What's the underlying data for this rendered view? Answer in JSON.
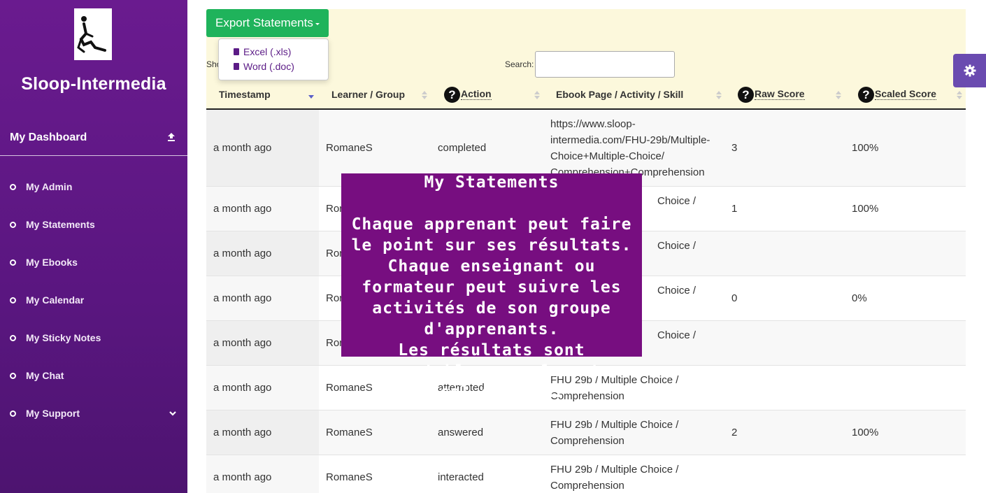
{
  "sidebar": {
    "brand": "Sloop-Intermedia",
    "dashboard_label": "My Dashboard",
    "items": [
      {
        "label": "My Admin"
      },
      {
        "label": "My Statements"
      },
      {
        "label": "My Ebooks"
      },
      {
        "label": "My Calendar"
      },
      {
        "label": "My Sticky Notes"
      },
      {
        "label": "My Chat"
      },
      {
        "label": "My Support"
      }
    ]
  },
  "toolbar": {
    "export_label": "Export Statements",
    "export_options": [
      "Excel (.xls)",
      "Word (.doc)"
    ],
    "show_label": "Sho",
    "search_label": "Search:",
    "search_value": ""
  },
  "table": {
    "headers": [
      "Timestamp",
      "Learner / Group",
      "Action",
      "Ebook Page / Activity / Skill",
      "Raw Score",
      "Scaled Score"
    ],
    "rows": [
      {
        "ts": "a month ago",
        "learner": "RomaneS",
        "action": "completed",
        "ebook": [
          "https://www.sloop-",
          "intermedia.com/FHU-29b/Multiple-",
          "Choice+Multiple-Choice/",
          "Comprehension+Comprehension"
        ],
        "raw": "3",
        "scaled": "100%"
      },
      {
        "ts": "a month ago",
        "learner": "Ror",
        "action": "",
        "ebook": [
          "Choice /"
        ],
        "raw": "1",
        "scaled": "100%"
      },
      {
        "ts": "a month ago",
        "learner": "Ror",
        "action": "",
        "ebook": [
          "Choice /"
        ],
        "raw": "",
        "scaled": ""
      },
      {
        "ts": "a month ago",
        "learner": "Ror",
        "action": "",
        "ebook": [
          "Choice /"
        ],
        "raw": "0",
        "scaled": "0%"
      },
      {
        "ts": "a month ago",
        "learner": "Ror",
        "action": "",
        "ebook": [
          "Choice /"
        ],
        "raw": "",
        "scaled": ""
      },
      {
        "ts": "a month ago",
        "learner": "RomaneS",
        "action": "attempted",
        "ebook": [
          "FHU 29b / Multiple Choice /",
          "Comprehension"
        ],
        "raw": "",
        "scaled": ""
      },
      {
        "ts": "a month ago",
        "learner": "RomaneS",
        "action": "answered",
        "ebook": [
          "FHU 29b / Multiple Choice /",
          "Comprehension"
        ],
        "raw": "2",
        "scaled": "100%"
      },
      {
        "ts": "a month ago",
        "learner": "RomaneS",
        "action": "interacted",
        "ebook": [
          "FHU 29b / Multiple Choice /",
          "Comprehension"
        ],
        "raw": "",
        "scaled": ""
      }
    ]
  },
  "overlay": {
    "title": "My Statements",
    "body": "Chaque apprenant peut faire le point sur ses résultats.\nChaque enseignant ou formateur peut suivre les activités de son groupe d'apprenants.\nLes résultats sont exportables aux formats Excel ou Word."
  },
  "colors": {
    "sidebar": "#6a1b8f",
    "export_button": "#1fb35b",
    "toolbar_bg": "#fcf8dc",
    "overlay": "#770e80",
    "gear_tab": "#6a4bb0"
  }
}
